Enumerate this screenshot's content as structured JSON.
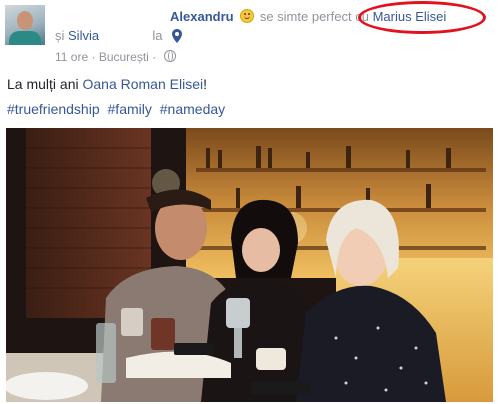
{
  "post": {
    "author": "Alexandru",
    "feeling": "se simte perfect",
    "with_prefix": "cu",
    "tagged_person": "Marius Elisei",
    "and_prefix": "și",
    "tagged_person_2": "Silvia",
    "location_prefix": "la",
    "time": "11 ore",
    "separator": "·",
    "place": "București",
    "separator2": "·",
    "message_prefix": "La mulți ani",
    "message_mention": "Oana Roman Elisei",
    "message_suffix": "!",
    "hashtags": [
      "#truefriendship",
      "#family",
      "#nameday"
    ]
  },
  "icons": {
    "emoji": "smiling-face-icon",
    "location": "map-pin-icon",
    "privacy": "globe-icon"
  },
  "colors": {
    "link": "#365899",
    "meta": "#90949c",
    "highlight_circle": "#e3111b"
  }
}
